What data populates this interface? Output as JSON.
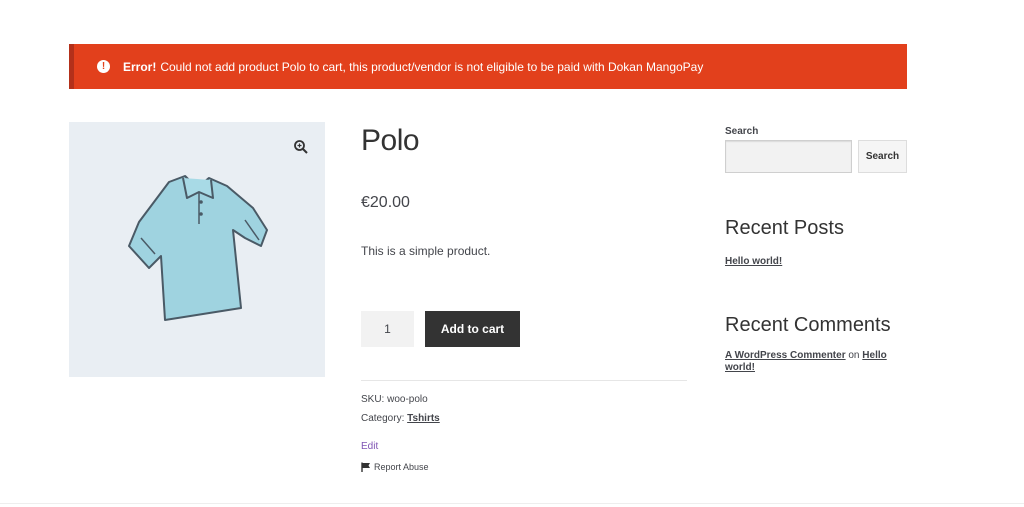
{
  "notice": {
    "strong": "Error!",
    "message": "Could not add product Polo to cart, this product/vendor is not eligible to be paid with Dokan MangoPay",
    "icon": "exclamation-circle-icon",
    "color": "#e2401c"
  },
  "product": {
    "title": "Polo",
    "price": "€20.00",
    "description": "This is a simple product.",
    "quantity": "1",
    "add_to_cart_label": "Add to cart",
    "sku_label": "SKU:",
    "sku_value": "woo-polo",
    "category_label": "Category:",
    "category_value": "Tshirts",
    "edit_label": "Edit",
    "report_label": "Report Abuse"
  },
  "sidebar": {
    "search_label": "Search",
    "search_value": "",
    "search_button": "Search",
    "recent_posts_title": "Recent Posts",
    "posts": [
      "Hello world!"
    ],
    "recent_comments_title": "Recent Comments",
    "comment_author": "A WordPress Commenter",
    "comment_on": "on",
    "comment_post": "Hello world!"
  }
}
